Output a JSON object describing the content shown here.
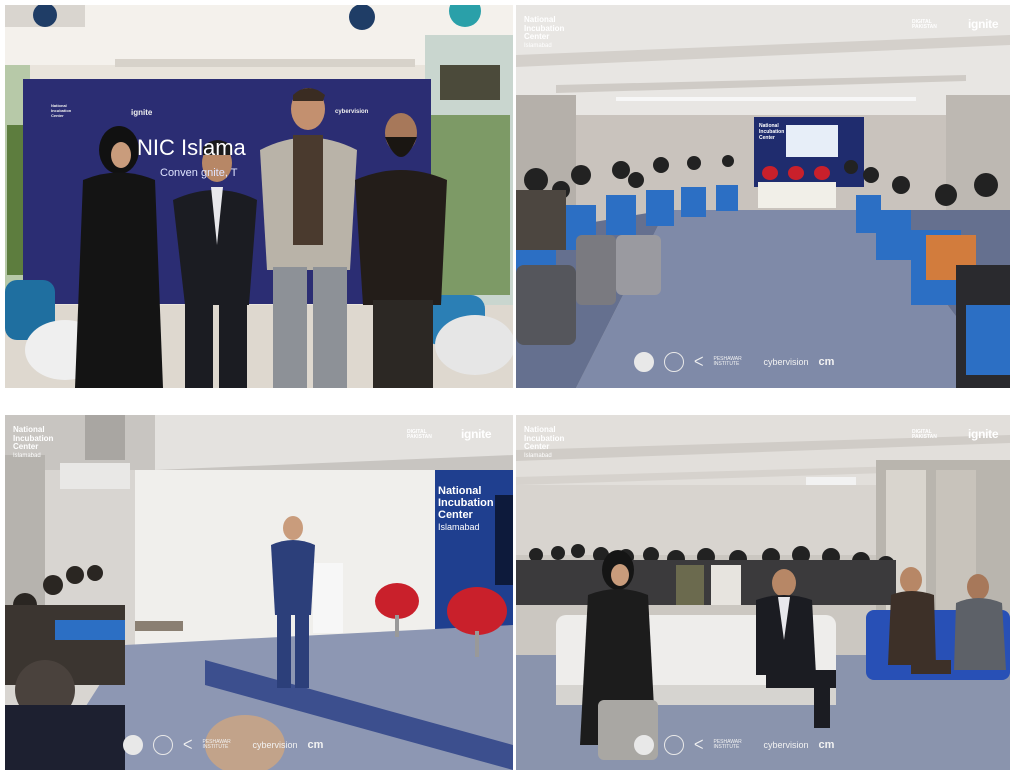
{
  "photos": {
    "tl": {
      "banner_title": "NIC Islama",
      "banner_subtitle": "Conven      gnite, T",
      "banner_logo_ignite": "ignite",
      "banner_logo_nic": "National Incubation Center",
      "banner_logo_cybervision": "cybervision"
    },
    "tr": {
      "nic_logo": [
        "National",
        "Incubation",
        "Center",
        "Islamabad"
      ],
      "digital_pakistan": "DIGITAL PAKISTAN",
      "ignite_logo": "ignite",
      "stage_backdrop": "National Incubation Center"
    },
    "bl": {
      "nic_logo": [
        "National",
        "Incubation",
        "Center",
        "Islamabad"
      ],
      "digital_pakistan": "DIGITAL PAKISTAN",
      "ignite_logo": "ignite",
      "backdrop": [
        "National",
        "Incubation",
        "Center"
      ],
      "backdrop_city": "Islamabad"
    },
    "br": {
      "nic_logo": [
        "National",
        "Incubation",
        "Center",
        "Islamabad"
      ],
      "digital_pakistan": "DIGITAL PAKISTAN",
      "ignite_logo": "ignite"
    }
  },
  "partners": {
    "telenor_mark": "ᐸ",
    "hec_like": "PESHAWAR INSTITUTE",
    "cybervision": "cybervision",
    "cm": "cm"
  },
  "colors": {
    "carpet": "#7f8aa8",
    "chair_blue": "#2c6fc4",
    "banner_navy": "#2b2d73",
    "red_chair": "#c9202b",
    "backdrop_blue": "#1f3f8f"
  }
}
